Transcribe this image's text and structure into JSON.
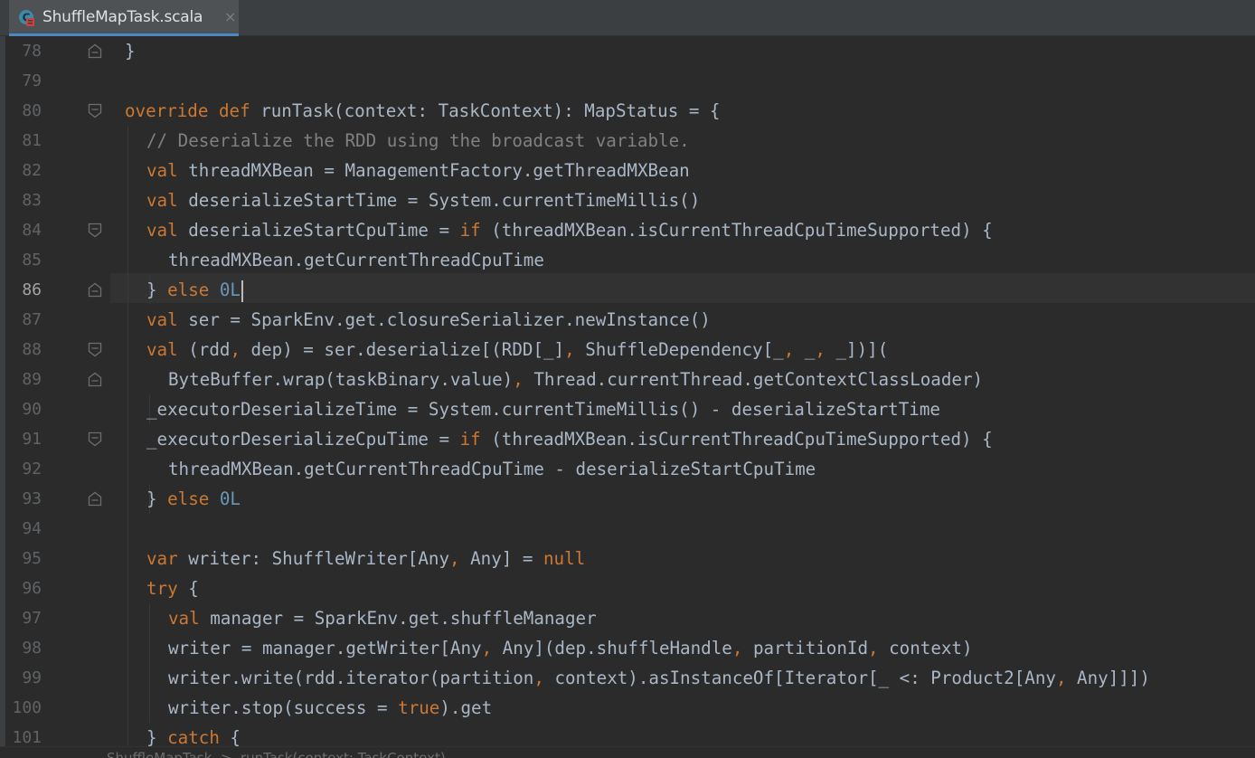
{
  "tab": {
    "file_name": "ShuffleMapTask.scala",
    "close_glyph": "×",
    "icon": "scala-class-icon"
  },
  "editor": {
    "current_line": 86,
    "lines": [
      {
        "n": "78",
        "fold": "end",
        "indent": 0,
        "tokens": [
          {
            "t": "}",
            "c": ""
          }
        ]
      },
      {
        "n": "79",
        "fold": "",
        "indent": 0,
        "tokens": []
      },
      {
        "n": "80",
        "fold": "start",
        "indent": 0,
        "tokens": [
          {
            "t": "override def ",
            "c": "kw"
          },
          {
            "t": "runTask(context: TaskContext): MapStatus = {",
            "c": ""
          }
        ]
      },
      {
        "n": "81",
        "fold": "",
        "indent": 1,
        "tokens": [
          {
            "t": "// Deserialize the RDD using the broadcast variable.",
            "c": "cm"
          }
        ]
      },
      {
        "n": "82",
        "fold": "",
        "indent": 1,
        "tokens": [
          {
            "t": "val ",
            "c": "kw"
          },
          {
            "t": "threadMXBean = ManagementFactory.getThreadMXBean",
            "c": ""
          }
        ]
      },
      {
        "n": "83",
        "fold": "",
        "indent": 1,
        "tokens": [
          {
            "t": "val ",
            "c": "kw"
          },
          {
            "t": "deserializeStartTime = System.currentTimeMillis()",
            "c": ""
          }
        ]
      },
      {
        "n": "84",
        "fold": "start",
        "indent": 1,
        "tokens": [
          {
            "t": "val ",
            "c": "kw"
          },
          {
            "t": "deserializeStartCpuTime = ",
            "c": ""
          },
          {
            "t": "if ",
            "c": "kw"
          },
          {
            "t": "(threadMXBean.isCurrentThreadCpuTimeSupported) {",
            "c": ""
          }
        ]
      },
      {
        "n": "85",
        "fold": "",
        "indent": 2,
        "tokens": [
          {
            "t": "threadMXBean.getCurrentThreadCpuTime",
            "c": ""
          }
        ]
      },
      {
        "n": "86",
        "fold": "end",
        "indent": 1,
        "tokens": [
          {
            "t": "} ",
            "c": ""
          },
          {
            "t": "else ",
            "c": "kw"
          },
          {
            "t": "0L",
            "c": "num"
          }
        ],
        "cursor": true
      },
      {
        "n": "87",
        "fold": "",
        "indent": 1,
        "tokens": [
          {
            "t": "val ",
            "c": "kw"
          },
          {
            "t": "ser = SparkEnv.get.closureSerializer.newInstance()",
            "c": ""
          }
        ]
      },
      {
        "n": "88",
        "fold": "start",
        "indent": 1,
        "tokens": [
          {
            "t": "val ",
            "c": "kw"
          },
          {
            "t": "(rdd",
            "c": ""
          },
          {
            "t": ", ",
            "c": "kw"
          },
          {
            "t": "dep) = ser.deserialize[(RDD[_]",
            "c": ""
          },
          {
            "t": ", ",
            "c": "kw"
          },
          {
            "t": "ShuffleDependency[_",
            "c": ""
          },
          {
            "t": ", ",
            "c": "kw"
          },
          {
            "t": "_",
            "c": ""
          },
          {
            "t": ", ",
            "c": "kw"
          },
          {
            "t": "_])](",
            "c": ""
          }
        ]
      },
      {
        "n": "89",
        "fold": "end",
        "indent": 2,
        "tokens": [
          {
            "t": "ByteBuffer.wrap(taskBinary.value)",
            "c": ""
          },
          {
            "t": ", ",
            "c": "kw"
          },
          {
            "t": "Thread.currentThread.getContextClassLoader)",
            "c": ""
          }
        ]
      },
      {
        "n": "90",
        "fold": "",
        "indent": 1,
        "tokens": [
          {
            "t": "_executorDeserializeTime = System.currentTimeMillis() - deserializeStartTime",
            "c": ""
          }
        ]
      },
      {
        "n": "91",
        "fold": "start",
        "indent": 1,
        "tokens": [
          {
            "t": "_executorDeserializeCpuTime = ",
            "c": ""
          },
          {
            "t": "if ",
            "c": "kw"
          },
          {
            "t": "(threadMXBean.isCurrentThreadCpuTimeSupported) {",
            "c": ""
          }
        ]
      },
      {
        "n": "92",
        "fold": "",
        "indent": 2,
        "tokens": [
          {
            "t": "threadMXBean.getCurrentThreadCpuTime - deserializeStartCpuTime",
            "c": ""
          }
        ]
      },
      {
        "n": "93",
        "fold": "end",
        "indent": 1,
        "tokens": [
          {
            "t": "} ",
            "c": ""
          },
          {
            "t": "else ",
            "c": "kw"
          },
          {
            "t": "0L",
            "c": "num"
          }
        ]
      },
      {
        "n": "94",
        "fold": "",
        "indent": 0,
        "tokens": []
      },
      {
        "n": "95",
        "fold": "",
        "indent": 1,
        "tokens": [
          {
            "t": "var ",
            "c": "kw"
          },
          {
            "t": "writer: ShuffleWriter[Any",
            "c": ""
          },
          {
            "t": ", ",
            "c": "kw"
          },
          {
            "t": "Any] = ",
            "c": ""
          },
          {
            "t": "null",
            "c": "kw"
          }
        ]
      },
      {
        "n": "96",
        "fold": "",
        "indent": 1,
        "tokens": [
          {
            "t": "try ",
            "c": "kw"
          },
          {
            "t": "{",
            "c": ""
          }
        ]
      },
      {
        "n": "97",
        "fold": "",
        "indent": 2,
        "tokens": [
          {
            "t": "val ",
            "c": "kw"
          },
          {
            "t": "manager = SparkEnv.get.shuffleManager",
            "c": ""
          }
        ]
      },
      {
        "n": "98",
        "fold": "",
        "indent": 2,
        "tokens": [
          {
            "t": "writer = manager.getWriter[Any",
            "c": ""
          },
          {
            "t": ", ",
            "c": "kw"
          },
          {
            "t": "Any](dep.shuffleHandle",
            "c": ""
          },
          {
            "t": ", ",
            "c": "kw"
          },
          {
            "t": "partitionId",
            "c": ""
          },
          {
            "t": ", ",
            "c": "kw"
          },
          {
            "t": "context)",
            "c": ""
          }
        ]
      },
      {
        "n": "99",
        "fold": "",
        "indent": 2,
        "tokens": [
          {
            "t": "writer.write(rdd.iterator(partition",
            "c": ""
          },
          {
            "t": ", ",
            "c": "kw"
          },
          {
            "t": "context).asInstanceOf[Iterator[_ <: Product2[Any",
            "c": ""
          },
          {
            "t": ", ",
            "c": "kw"
          },
          {
            "t": "Any]]])",
            "c": ""
          }
        ]
      },
      {
        "n": "100",
        "fold": "",
        "indent": 2,
        "tokens": [
          {
            "t": "writer.stop(success = ",
            "c": ""
          },
          {
            "t": "true",
            "c": "kw"
          },
          {
            "t": ").get",
            "c": ""
          }
        ]
      },
      {
        "n": "101",
        "fold": "",
        "indent": 1,
        "tokens": [
          {
            "t": "} ",
            "c": ""
          },
          {
            "t": "catch ",
            "c": "kw"
          },
          {
            "t": "{",
            "c": ""
          }
        ]
      }
    ]
  },
  "breadcrumb": {
    "text": "ShuffleMapTask  >  runTask(context: TaskContext)"
  },
  "colors": {
    "background": "#2b2b2b",
    "keyword": "#cc7832",
    "number": "#6897bb",
    "comment": "#808080",
    "text": "#a9b7c6",
    "line_number": "#606366",
    "tab_accent": "#4a88c7"
  }
}
